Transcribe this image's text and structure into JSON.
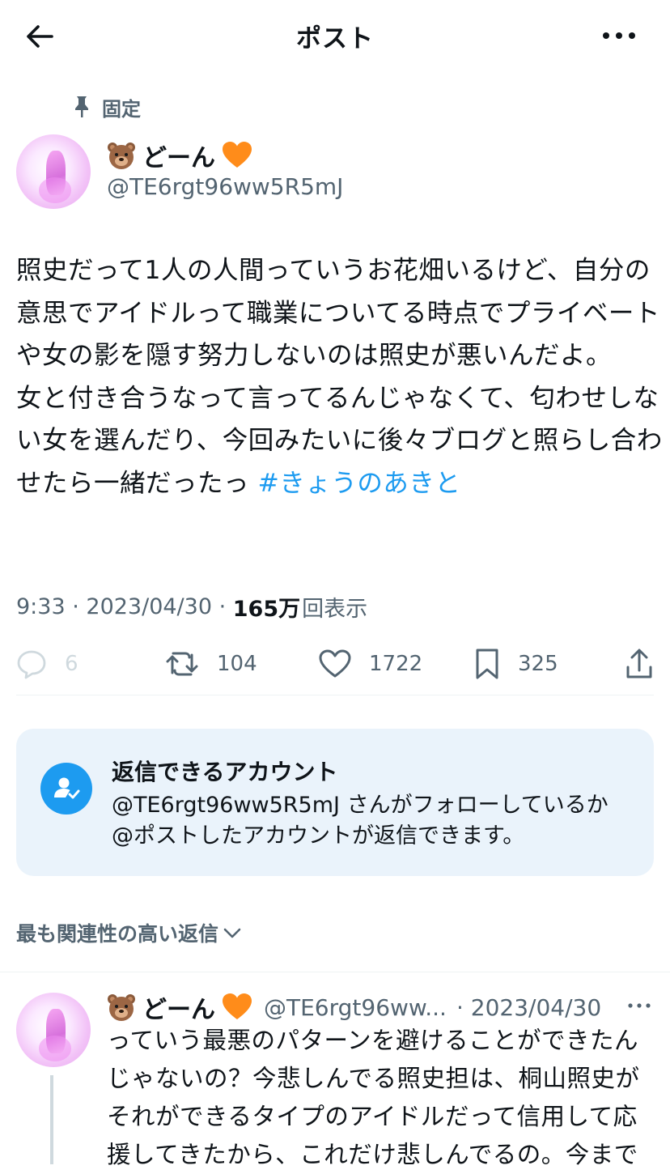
{
  "header": {
    "title": "ポスト",
    "back_icon": "arrow-left-icon",
    "more_icon": "more-dots-icon"
  },
  "pinned": {
    "label": "固定",
    "icon": "pin-icon"
  },
  "tweet": {
    "display_name": "どーん",
    "handle": "@TE6rgt96ww5R5mJ",
    "text": "照史だって1人の人間っていうお花畑いるけど、自分の意思でアイドルって職業についてる時点でプライベートや女の影を隠す努力しないのは照史が悪いんだよ。\n女と付き合うなって言ってるんじゃなくて、匂わせしない女を選んだり、今回みたいに後々ブログと照らし合わせたら一緒だったっ ",
    "hashtag": "#きょうのあきと",
    "time": "9:33",
    "date": "2023/04/30",
    "separator": " · ",
    "views_count": "165万",
    "views_label": "回表示"
  },
  "actions": {
    "replies": "6",
    "reposts": "104",
    "likes": "1722",
    "bookmarks": "325"
  },
  "reply_info": {
    "title": "返信できるアカウント",
    "description": "@TE6rgt96ww5R5mJ さんがフォローしているか@ポストしたアカウントが返信できます。"
  },
  "sort": {
    "label": "最も関連性の高い返信"
  },
  "reply": {
    "display_name": "どーん",
    "handle": "@TE6rgt96ww...",
    "date": "· 2023/04/30",
    "text": "っていう最悪のパターンを避けることができたんじゃないの？今悲しんでる照史担は、桐山照史がそれができるタイプのアイドルだって信用して応援してきたから、これだけ悲しんでるの。今まで"
  },
  "colors": {
    "accent": "#1d9bf0",
    "muted": "#536471",
    "text": "#0f1419",
    "info_bg": "#eaf3fb"
  }
}
